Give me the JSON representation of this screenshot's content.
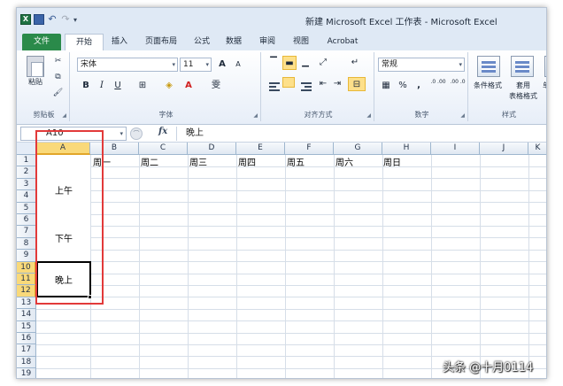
{
  "window": {
    "title": "新建 Microsoft Excel 工作表 - Microsoft Excel"
  },
  "qat": {
    "app_icon": "X",
    "icons": [
      "excel-icon",
      "save-icon",
      "undo-icon",
      "redo-icon",
      "customize-icon"
    ]
  },
  "tabs": [
    {
      "label": "文件"
    },
    {
      "label": "开始"
    },
    {
      "label": "插入"
    },
    {
      "label": "页面布局"
    },
    {
      "label": "公式"
    },
    {
      "label": "数据"
    },
    {
      "label": "审阅"
    },
    {
      "label": "视图"
    },
    {
      "label": "Acrobat"
    }
  ],
  "ribbon": {
    "clipboard": {
      "group_label": "剪贴板",
      "paste_label": "粘贴"
    },
    "font": {
      "group_label": "字体",
      "font_name": "宋体",
      "font_size": "11",
      "bold": "B",
      "italic": "I",
      "underline": "U",
      "grow": "A",
      "shrink": "A",
      "wen": "雯"
    },
    "alignment": {
      "group_label": "对齐方式"
    },
    "number": {
      "group_label": "数字",
      "format": "常规",
      "percent": "%",
      "comma": ",",
      "inc_decimal": ".0 .00",
      "dec_decimal": ".00 .0"
    },
    "styles": {
      "group_label": "样式",
      "cond_format": "条件格式",
      "table_format_1": "套用",
      "table_format_2": "表格格式",
      "cell_styles": "单元"
    }
  },
  "formula_bar": {
    "name_box": "A10",
    "fx": "fx",
    "value": "晚上"
  },
  "grid": {
    "columns": [
      "A",
      "B",
      "C",
      "D",
      "E",
      "F",
      "G",
      "H",
      "I",
      "J",
      "K"
    ],
    "rows": [
      "1",
      "2",
      "3",
      "4",
      "5",
      "6",
      "7",
      "8",
      "9",
      "10",
      "11",
      "12",
      "13",
      "14",
      "15",
      "16",
      "17",
      "18",
      "19"
    ],
    "row1_cells": [
      {
        "col": "B",
        "text": "周一"
      },
      {
        "col": "C",
        "text": "周二"
      },
      {
        "col": "D",
        "text": "周三"
      },
      {
        "col": "E",
        "text": "周四"
      },
      {
        "col": "F",
        "text": "周五"
      },
      {
        "col": "G",
        "text": "周六"
      },
      {
        "col": "H",
        "text": "周日"
      }
    ],
    "merged": [
      {
        "range": "A2:A5",
        "text": "上午"
      },
      {
        "range": "A6:A9",
        "text": "下午"
      },
      {
        "range": "A10:A12",
        "text": "晚上"
      }
    ],
    "selected_cell": "A10"
  },
  "watermark": "头条 @十月0114",
  "colors": {
    "file_tab": "#2a8a4a",
    "selection_header": "#f9d97a",
    "highlight_box": "#e23a3a"
  }
}
